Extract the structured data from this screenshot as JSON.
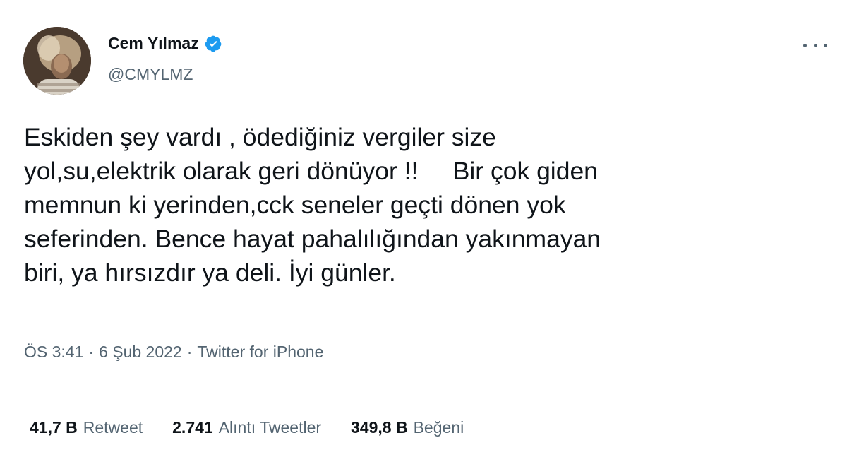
{
  "user": {
    "display_name": "Cem Yılmaz",
    "handle": "@CMYLMZ",
    "verified": true,
    "verified_color": "#1d9bf0"
  },
  "tweet": {
    "text": "Eskiden şey vardı , ödediğiniz vergiler size\nyol,su,elektrik olarak geri dönüyor !!     Bir çok giden\nmemnun ki yerinden,cck seneler geçti dönen yok\nseferinden. Bence hayat pahalılığından yakınmayan\nbiri, ya hırsızdır ya deli. İyi günler.",
    "time": "ÖS 3:41",
    "date": "6 Şub 2022",
    "separator": "·",
    "source": "Twitter for iPhone"
  },
  "stats": [
    {
      "value": "41,7 B",
      "label": "Retweet"
    },
    {
      "value": "2.741",
      "label": "Alıntı Tweetler"
    },
    {
      "value": "349,8 B",
      "label": "Beğeni"
    }
  ],
  "icons": {
    "more": "more-horizontal-icon",
    "verified": "verified-badge-icon"
  },
  "colors": {
    "text": "#0f1419",
    "secondary": "#536471",
    "divider": "#e6e9ea"
  }
}
